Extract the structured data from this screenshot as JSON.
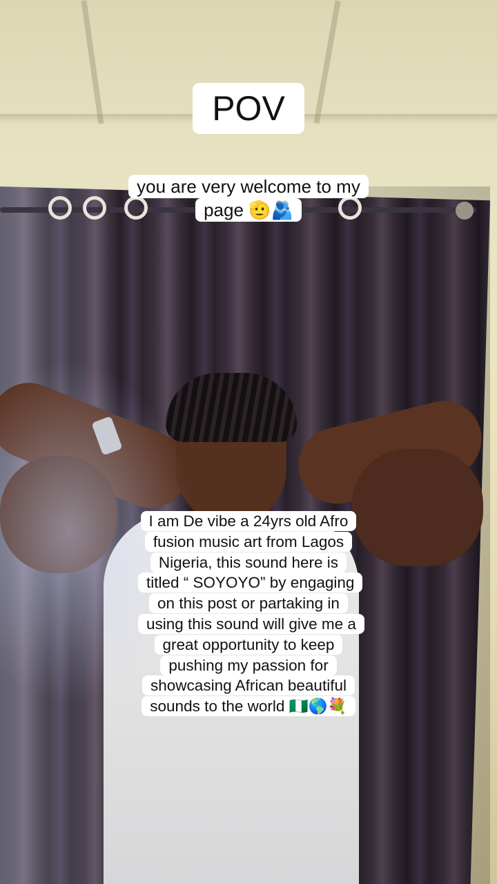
{
  "captions": {
    "pov": "POV",
    "welcome": "you are very welcome to my page 🫡🫂",
    "bio": "I am De vibe a 24yrs old Afro fusion music art from Lagos Nigeria, this sound here is titled “ SOYOYO” by engaging on this post or partaking in using this sound will give me a great opportunity to keep pushing my passion for showcasing African beautiful sounds to the world 🇳🇬🌎💐"
  }
}
